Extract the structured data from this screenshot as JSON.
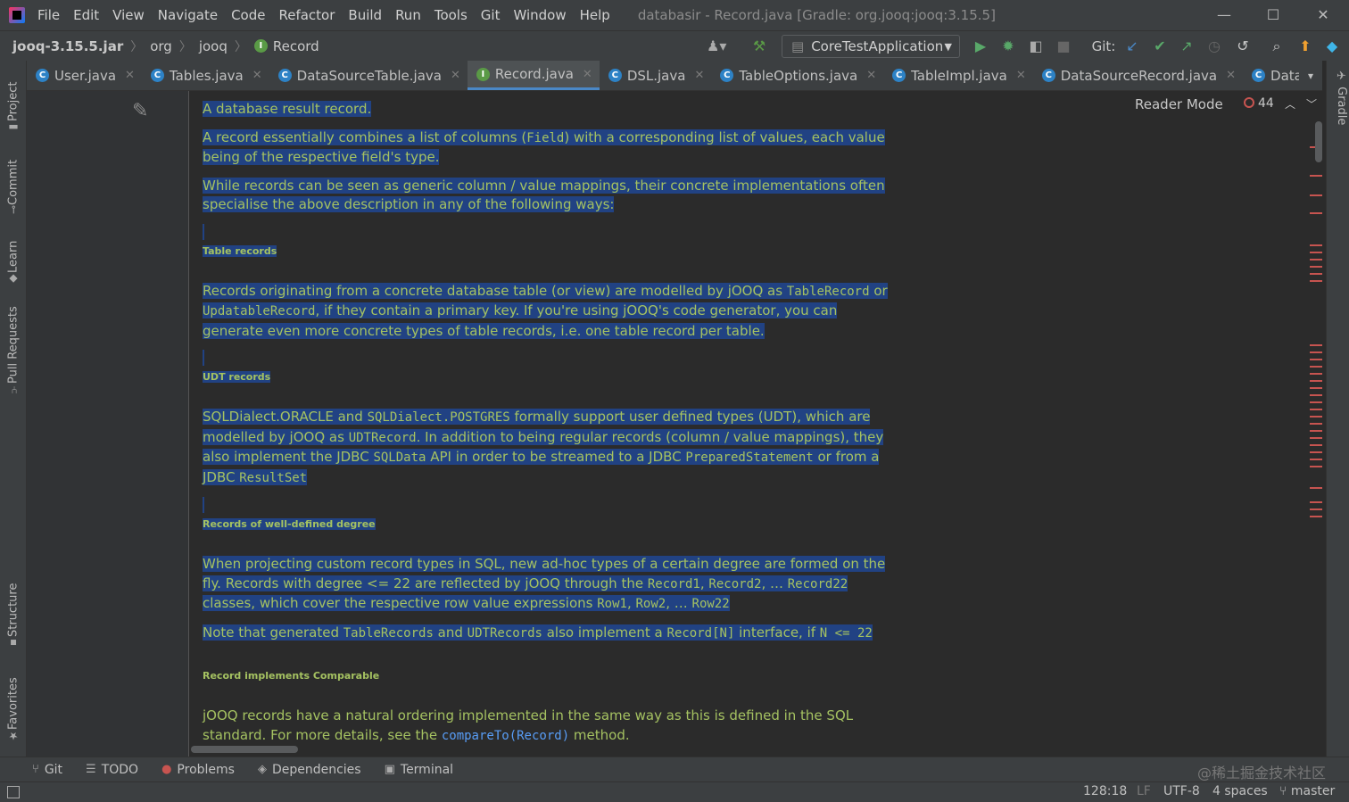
{
  "menu": [
    "File",
    "Edit",
    "View",
    "Navigate",
    "Code",
    "Refactor",
    "Build",
    "Run",
    "Tools",
    "Git",
    "Window",
    "Help"
  ],
  "window_title": "databasir - Record.java [Gradle: org.jooq:jooq:3.15.5]",
  "window_controls": {
    "minimize": "—",
    "maximize": "☐",
    "close": "✕"
  },
  "breadcrumb": {
    "root": "jooq-3.15.5.jar",
    "items": [
      "org",
      "jooq",
      "Record"
    ]
  },
  "toolbar": {
    "run_config": "CoreTestApplication",
    "git_label": "Git:"
  },
  "tabs": [
    {
      "label": "User.java",
      "icon": "class-icon",
      "active": false
    },
    {
      "label": "Tables.java",
      "icon": "class-icon",
      "active": false
    },
    {
      "label": "DataSourceTable.java",
      "icon": "class-icon",
      "active": false
    },
    {
      "label": "Record.java",
      "icon": "interface-icon",
      "active": true
    },
    {
      "label": "DSL.java",
      "icon": "class-icon",
      "active": false
    },
    {
      "label": "TableOptions.java",
      "icon": "class-icon",
      "active": false
    },
    {
      "label": "TableImpl.java",
      "icon": "class-icon",
      "active": false
    },
    {
      "label": "DataSourceRecord.java",
      "icon": "class-icon",
      "active": false
    },
    {
      "label": "DatabaseDocume",
      "icon": "class-icon",
      "active": false
    }
  ],
  "left_tools": [
    "Project",
    "Commit",
    "Learn",
    "Pull Requests",
    "Structure",
    "Favorites"
  ],
  "right_tools": [
    "Gradle"
  ],
  "editor": {
    "reader_mode": "Reader Mode",
    "error_count": "44",
    "doc": {
      "p1": "A database result record.",
      "p2a": "A record essentially combines a list of columns (",
      "p2b": "Field",
      "p2c": ") with a corresponding list of values, each value being of the respective field's type.",
      "p3": "While records can be seen as generic column / value mappings, their concrete implementations often specialise the above description in any of the following ways:",
      "h1": "Table records",
      "p4a": "Records originating from a concrete database table (or view) are modelled by jOOQ as ",
      "p4b": "TableRecord",
      "p4c": " or ",
      "p4d": "UpdatableRecord",
      "p4e": ", if they contain a primary key. If you're using jOOQ's code generator, you can generate even more concrete types of table records, i.e. one table record per table.",
      "h2": "UDT records",
      "p5a": "SQLDialect.ORACLE and ",
      "p5b": "SQLDialect.POSTGRES",
      "p5c": " formally support user defined types (UDT), which are modelled by jOOQ as ",
      "p5d": "UDTRecord",
      "p5e": ". In addition to being regular records (column / value mappings), they also implement the JDBC ",
      "p5f": "SQLData",
      "p5g": " API in order to be streamed to a JDBC ",
      "p5h": "PreparedStatement",
      "p5i": " or from a JDBC ",
      "p5j": "ResultSet",
      "h3": "Records of well-defined degree",
      "p6a": "When projecting custom record types in SQL, new ad-hoc types of a certain degree are formed on the fly. Records with degree <= 22 are reflected by jOOQ through the ",
      "p6b": "Record1",
      "p6c": ", ",
      "p6d": "Record2",
      "p6e": ", … ",
      "p6f": "Record22",
      "p6g": " classes, which cover the respective row value expressions ",
      "p6h": "Row1",
      "p6i": ", ",
      "p6j": "Row2",
      "p6k": ", … ",
      "p6l": "Row22",
      "p7a": "Note that generated ",
      "p7b": "TableRecords",
      "p7c": " and ",
      "p7d": "UDTRecords",
      "p7e": " also implement a ",
      "p7f": "Record[N]",
      "p7g": " interface, if ",
      "p7h": "N <= 22",
      "h4": "Record implements Comparable",
      "p8a": "jOOQ records have a natural ordering implemented in the same way as this is defined in the SQL standard. For more details, see the ",
      "p8b": "compareTo(Record)",
      "p8c": " method."
    }
  },
  "bottom_tools": [
    {
      "label": "Git",
      "icon": "git-branch-icon"
    },
    {
      "label": "TODO",
      "icon": "list-icon"
    },
    {
      "label": "Problems",
      "icon": "error-icon"
    },
    {
      "label": "Dependencies",
      "icon": "layers-icon"
    },
    {
      "label": "Terminal",
      "icon": "terminal-icon"
    }
  ],
  "watermark": "@稀土掘金技术社区",
  "status": {
    "position": "128:18",
    "line_sep": "LF",
    "encoding": "UTF-8",
    "indent": "4 spaces",
    "branch": "master"
  },
  "colors": {
    "doc_text": "#a5c261",
    "selection": "#214283",
    "link": "#589df6",
    "error": "#c75450"
  }
}
